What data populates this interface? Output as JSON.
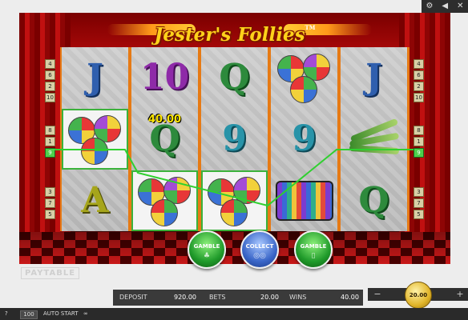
{
  "window": {
    "controls": [
      "gear-icon",
      "sound-icon",
      "close-icon"
    ]
  },
  "game": {
    "title": "Jester's Follies",
    "trademark": "TM"
  },
  "reels": [
    [
      "J",
      "ball-symbol",
      "A"
    ],
    [
      "10",
      "Q",
      "ball-symbol"
    ],
    [
      "Q",
      "9",
      "ball-symbol"
    ],
    [
      "ball-symbol",
      "9",
      "accordion-symbol"
    ],
    [
      "J",
      "pins-symbol",
      "Q"
    ]
  ],
  "win_amount": "40.00",
  "line_markers": {
    "left_top": [
      "4",
      "6",
      "2",
      "10"
    ],
    "left_mid": [
      "8",
      "1",
      "9"
    ],
    "left_bottom": [
      "3",
      "7",
      "5"
    ],
    "right_top": [
      "4",
      "6",
      "2",
      "10"
    ],
    "right_mid": [
      "8",
      "1",
      "9"
    ],
    "right_bottom": [
      "3",
      "7",
      "5"
    ],
    "active": "9",
    "active_color": "#4cd04c"
  },
  "buttons": {
    "gamble_left": "GAMBLE",
    "collect": "COLLECT",
    "gamble_right": "GAMBLE"
  },
  "paytable_label": "PAYTABLE",
  "stats": {
    "deposit_label": "DEPOSIT",
    "deposit_value": "920.00",
    "bets_label": "BETS",
    "bets_value": "20.00",
    "wins_label": "WINS",
    "wins_value": "40.00"
  },
  "bet": {
    "minus": "−",
    "plus": "+",
    "value": "20.00"
  },
  "footer": {
    "help": "?",
    "autostart_count": "100",
    "autostart_label": "AUTO START",
    "loop_icon": "loop-icon"
  },
  "colors": {
    "reel_frame": "#e67a14",
    "win_outline": "#3bb23b",
    "logo": "#ffd21a"
  }
}
